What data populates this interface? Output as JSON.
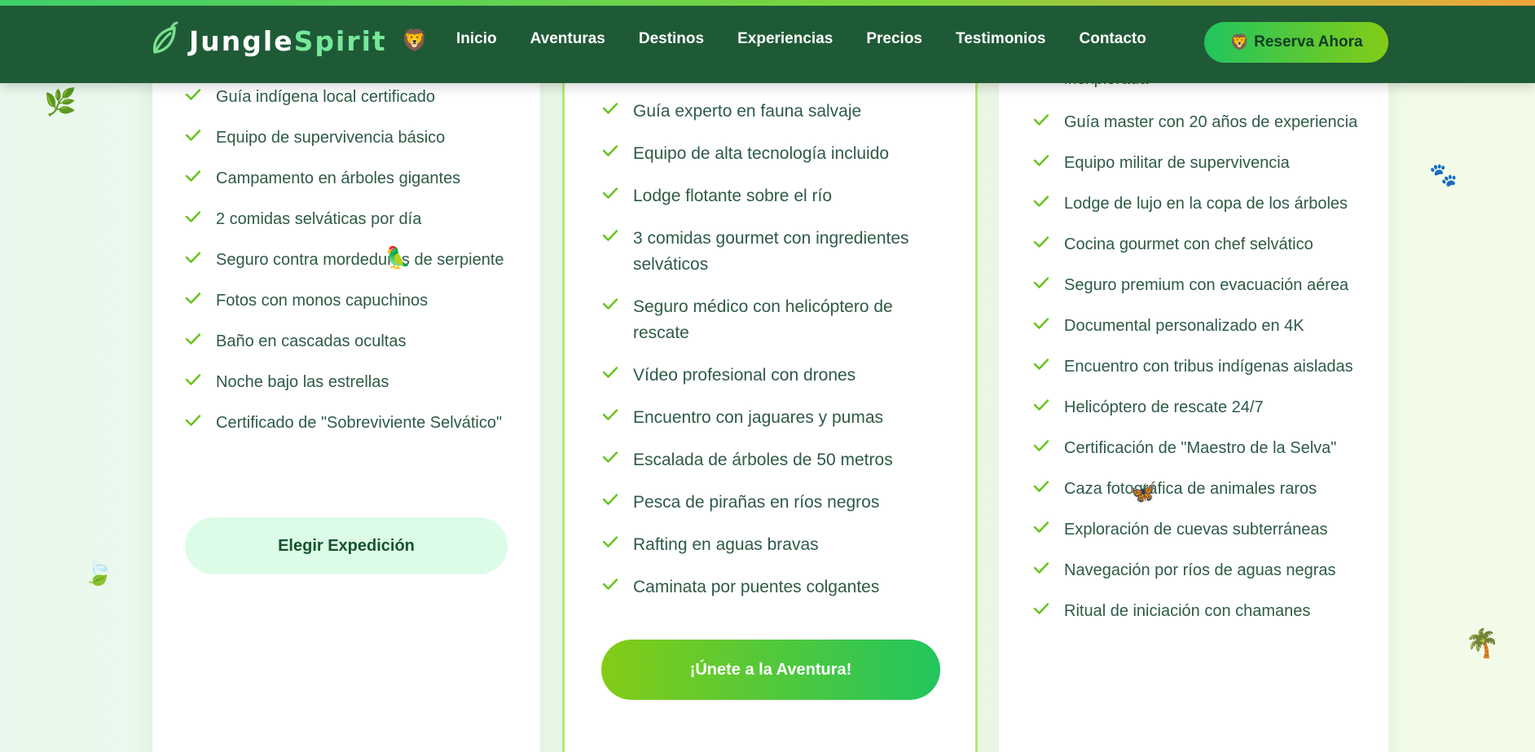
{
  "brand": {
    "name_part1": "Jungle",
    "name_part2": "Spirit",
    "emoji": "🦁"
  },
  "nav": [
    "Inicio",
    "Aventuras",
    "Destinos",
    "Experiencias",
    "Precios",
    "Testimonios",
    "Contacto"
  ],
  "cta": {
    "emoji": "🦁",
    "label": "Reserva Ahora"
  },
  "plans": {
    "left": {
      "features": [
        "Guía indígena local certificado",
        "Equipo de supervivencia básico",
        "Campamento en árboles gigantes",
        "2 comidas selváticas por día",
        "Seguro contra mordeduras de serpiente",
        "Fotos con monos capuchinos",
        "Baño en cascadas ocultas",
        "Noche bajo las estrellas",
        "Certificado de \"Sobreviviente Selvático\""
      ],
      "button": "Elegir Expedición"
    },
    "middle": {
      "features": [
        "Guía experto en fauna salvaje",
        "Equipo de alta tecnología incluido",
        "Lodge flotante sobre el río",
        "3 comidas gourmet con ingredientes selváticos",
        "Seguro médico con helicóptero de rescate",
        "Vídeo profesional con drones",
        "Encuentro con jaguares y pumas",
        "Escalada de árboles de 50 metros",
        "Pesca de pirañas en ríos negros",
        "Rafting en aguas bravas",
        "Caminata por puentes colgantes"
      ],
      "button": "¡Únete a la Aventura!"
    },
    "right": {
      "cut_text": "inexplorada",
      "features": [
        "Guía master con 20 años de experiencia",
        "Equipo militar de supervivencia",
        "Lodge de lujo en la copa de los árboles",
        "Cocina gourmet con chef selvático",
        "Seguro premium con evacuación aérea",
        "Documental personalizado en 4K",
        "Encuentro con tribus indígenas aisladas",
        "Helicóptero de rescate 24/7",
        "Certificación de \"Maestro de la Selva\"",
        "Caza fotográfica de animales raros",
        "Exploración de cuevas subterráneas",
        "Navegación por ríos de aguas negras",
        "Ritual de iniciación con chamanes"
      ]
    }
  },
  "decorations": {
    "herb": "🌿",
    "leaf": "🍃",
    "paws": "🐾",
    "parrot": "🦜",
    "butterfly": "🦋",
    "palm": "🌴"
  },
  "colors": {
    "header_bg": "#1f5a36",
    "accent_green": "#22c55e",
    "accent_lime": "#84cc16",
    "check": "#65c31a",
    "text": "#2e5b45"
  }
}
